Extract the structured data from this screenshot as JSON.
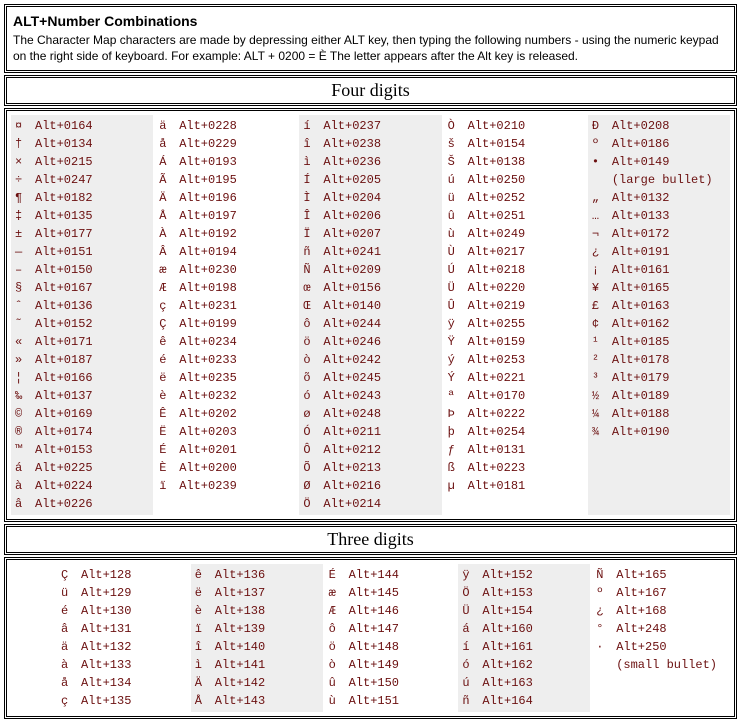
{
  "title": "ALT+Number Combinations",
  "desc": "The Character Map characters are made by depressing either ALT key, then typing the following numbers - using the numeric keypad on the right side of keyboard. For example: ALT + 0200 = È  The letter appears after the Alt key is released.",
  "section_four": "Four digits",
  "section_three": "Three digits",
  "four": {
    "c1": [
      [
        "¤",
        "Alt+0164"
      ],
      [
        "†",
        "Alt+0134"
      ],
      [
        "×",
        "Alt+0215"
      ],
      [
        "÷",
        "Alt+0247"
      ],
      [
        "¶",
        "Alt+0182"
      ],
      [
        "‡",
        "Alt+0135"
      ],
      [
        "±",
        "Alt+0177"
      ],
      [
        "—",
        "Alt+0151"
      ],
      [
        "–",
        "Alt+0150"
      ],
      [
        "§",
        "Alt+0167"
      ],
      [
        "ˆ",
        "Alt+0136"
      ],
      [
        "˜",
        "Alt+0152"
      ],
      [
        "«",
        "Alt+0171"
      ],
      [
        "»",
        "Alt+0187"
      ],
      [
        "¦",
        "Alt+0166"
      ],
      [
        "‰",
        "Alt+0137"
      ],
      [
        "©",
        "Alt+0169"
      ],
      [
        "®",
        "Alt+0174"
      ],
      [
        "™",
        "Alt+0153"
      ],
      [
        "á",
        "Alt+0225"
      ],
      [
        "à",
        "Alt+0224"
      ],
      [
        "â",
        "Alt+0226"
      ]
    ],
    "c2": [
      [
        "ä",
        "Alt+0228"
      ],
      [
        "å",
        "Alt+0229"
      ],
      [
        "Á",
        "Alt+0193"
      ],
      [
        "Ã",
        "Alt+0195"
      ],
      [
        "Ä",
        "Alt+0196"
      ],
      [
        "Å",
        "Alt+0197"
      ],
      [
        "À",
        "Alt+0192"
      ],
      [
        "Â",
        "Alt+0194"
      ],
      [
        "æ",
        "Alt+0230"
      ],
      [
        "Æ",
        "Alt+0198"
      ],
      [
        "ç",
        "Alt+0231"
      ],
      [
        "Ç",
        "Alt+0199"
      ],
      [
        "ê",
        "Alt+0234"
      ],
      [
        "é",
        "Alt+0233"
      ],
      [
        "ë",
        "Alt+0235"
      ],
      [
        "è",
        "Alt+0232"
      ],
      [
        "Ê",
        "Alt+0202"
      ],
      [
        "Ë",
        "Alt+0203"
      ],
      [
        "É",
        "Alt+0201"
      ],
      [
        "È",
        "Alt+0200"
      ],
      [
        "ï",
        "Alt+0239"
      ]
    ],
    "c3": [
      [
        "í",
        "Alt+0237"
      ],
      [
        "î",
        "Alt+0238"
      ],
      [
        "ì",
        "Alt+0236"
      ],
      [
        "Í",
        "Alt+0205"
      ],
      [
        "Ì",
        "Alt+0204"
      ],
      [
        "Î",
        "Alt+0206"
      ],
      [
        "Ï",
        "Alt+0207"
      ],
      [
        "ñ",
        "Alt+0241"
      ],
      [
        "Ñ",
        "Alt+0209"
      ],
      [
        "œ",
        "Alt+0156"
      ],
      [
        "Œ",
        "Alt+0140"
      ],
      [
        "ô",
        "Alt+0244"
      ],
      [
        "ö",
        "Alt+0246"
      ],
      [
        "ò",
        "Alt+0242"
      ],
      [
        "õ",
        "Alt+0245"
      ],
      [
        "ó",
        "Alt+0243"
      ],
      [
        "ø",
        "Alt+0248"
      ],
      [
        "Ó",
        "Alt+0211"
      ],
      [
        "Ô",
        "Alt+0212"
      ],
      [
        "Õ",
        "Alt+0213"
      ],
      [
        "Ø",
        "Alt+0216"
      ],
      [
        "Ö",
        "Alt+0214"
      ]
    ],
    "c4": [
      [
        "Ò",
        "Alt+0210"
      ],
      [
        "š",
        "Alt+0154"
      ],
      [
        "Š",
        "Alt+0138"
      ],
      [
        "ú",
        "Alt+0250"
      ],
      [
        "ü",
        "Alt+0252"
      ],
      [
        "û",
        "Alt+0251"
      ],
      [
        "ù",
        "Alt+0249"
      ],
      [
        "Ù",
        "Alt+0217"
      ],
      [
        "Ú",
        "Alt+0218"
      ],
      [
        "Ü",
        "Alt+0220"
      ],
      [
        "Û",
        "Alt+0219"
      ],
      [
        "ÿ",
        "Alt+0255"
      ],
      [
        "Ÿ",
        "Alt+0159"
      ],
      [
        "ý",
        "Alt+0253"
      ],
      [
        "Ý",
        "Alt+0221"
      ],
      [
        "ª",
        "Alt+0170"
      ],
      [
        "Þ",
        "Alt+0222"
      ],
      [
        "þ",
        "Alt+0254"
      ],
      [
        "ƒ",
        "Alt+0131"
      ],
      [
        "ß",
        "Alt+0223"
      ],
      [
        "µ",
        "Alt+0181"
      ]
    ],
    "c5": [
      [
        "Ð",
        "Alt+0208"
      ],
      [
        "º",
        "Alt+0186"
      ],
      [
        "•",
        "Alt+0149"
      ],
      [
        "",
        "(large bullet)"
      ],
      [
        "„",
        "Alt+0132"
      ],
      [
        "…",
        "Alt+0133"
      ],
      [
        "¬",
        "Alt+0172"
      ],
      [
        "¿",
        "Alt+0191"
      ],
      [
        "¡",
        "Alt+0161"
      ],
      [
        "¥",
        "Alt+0165"
      ],
      [
        "£",
        "Alt+0163"
      ],
      [
        "¢",
        "Alt+0162"
      ],
      [
        "¹",
        "Alt+0185"
      ],
      [
        "²",
        "Alt+0178"
      ],
      [
        "³",
        "Alt+0179"
      ],
      [
        "½",
        "Alt+0189"
      ],
      [
        "¼",
        "Alt+0188"
      ],
      [
        "¾",
        "Alt+0190"
      ]
    ]
  },
  "three": {
    "c1": [
      [
        "Ç",
        "Alt+128"
      ],
      [
        "ü",
        "Alt+129"
      ],
      [
        "é",
        "Alt+130"
      ],
      [
        "â",
        "Alt+131"
      ],
      [
        "ä",
        "Alt+132"
      ],
      [
        "à",
        "Alt+133"
      ],
      [
        "å",
        "Alt+134"
      ],
      [
        "ç",
        "Alt+135"
      ]
    ],
    "c2": [
      [
        "ê",
        "Alt+136"
      ],
      [
        "ë",
        "Alt+137"
      ],
      [
        "è",
        "Alt+138"
      ],
      [
        "ï",
        "Alt+139"
      ],
      [
        "î",
        "Alt+140"
      ],
      [
        "ì",
        "Alt+141"
      ],
      [
        "Ä",
        "Alt+142"
      ],
      [
        "Å",
        "Alt+143"
      ]
    ],
    "c3": [
      [
        "É",
        "Alt+144"
      ],
      [
        "æ",
        "Alt+145"
      ],
      [
        "Æ",
        "Alt+146"
      ],
      [
        "ô",
        "Alt+147"
      ],
      [
        "ö",
        "Alt+148"
      ],
      [
        "ò",
        "Alt+149"
      ],
      [
        "û",
        "Alt+150"
      ],
      [
        "ù",
        "Alt+151"
      ]
    ],
    "c4": [
      [
        "ÿ",
        "Alt+152"
      ],
      [
        "Ö",
        "Alt+153"
      ],
      [
        "Ü",
        "Alt+154"
      ],
      [
        "á",
        "Alt+160"
      ],
      [
        "í",
        "Alt+161"
      ],
      [
        "ó",
        "Alt+162"
      ],
      [
        "ú",
        "Alt+163"
      ],
      [
        "ñ",
        "Alt+164"
      ]
    ],
    "c5": [
      [
        "Ñ",
        "Alt+165"
      ],
      [
        "º",
        "Alt+167"
      ],
      [
        "¿",
        "Alt+168"
      ],
      [
        "°",
        "Alt+248"
      ],
      [
        "·",
        "Alt+250"
      ],
      [
        "",
        "(small bullet)"
      ]
    ]
  }
}
